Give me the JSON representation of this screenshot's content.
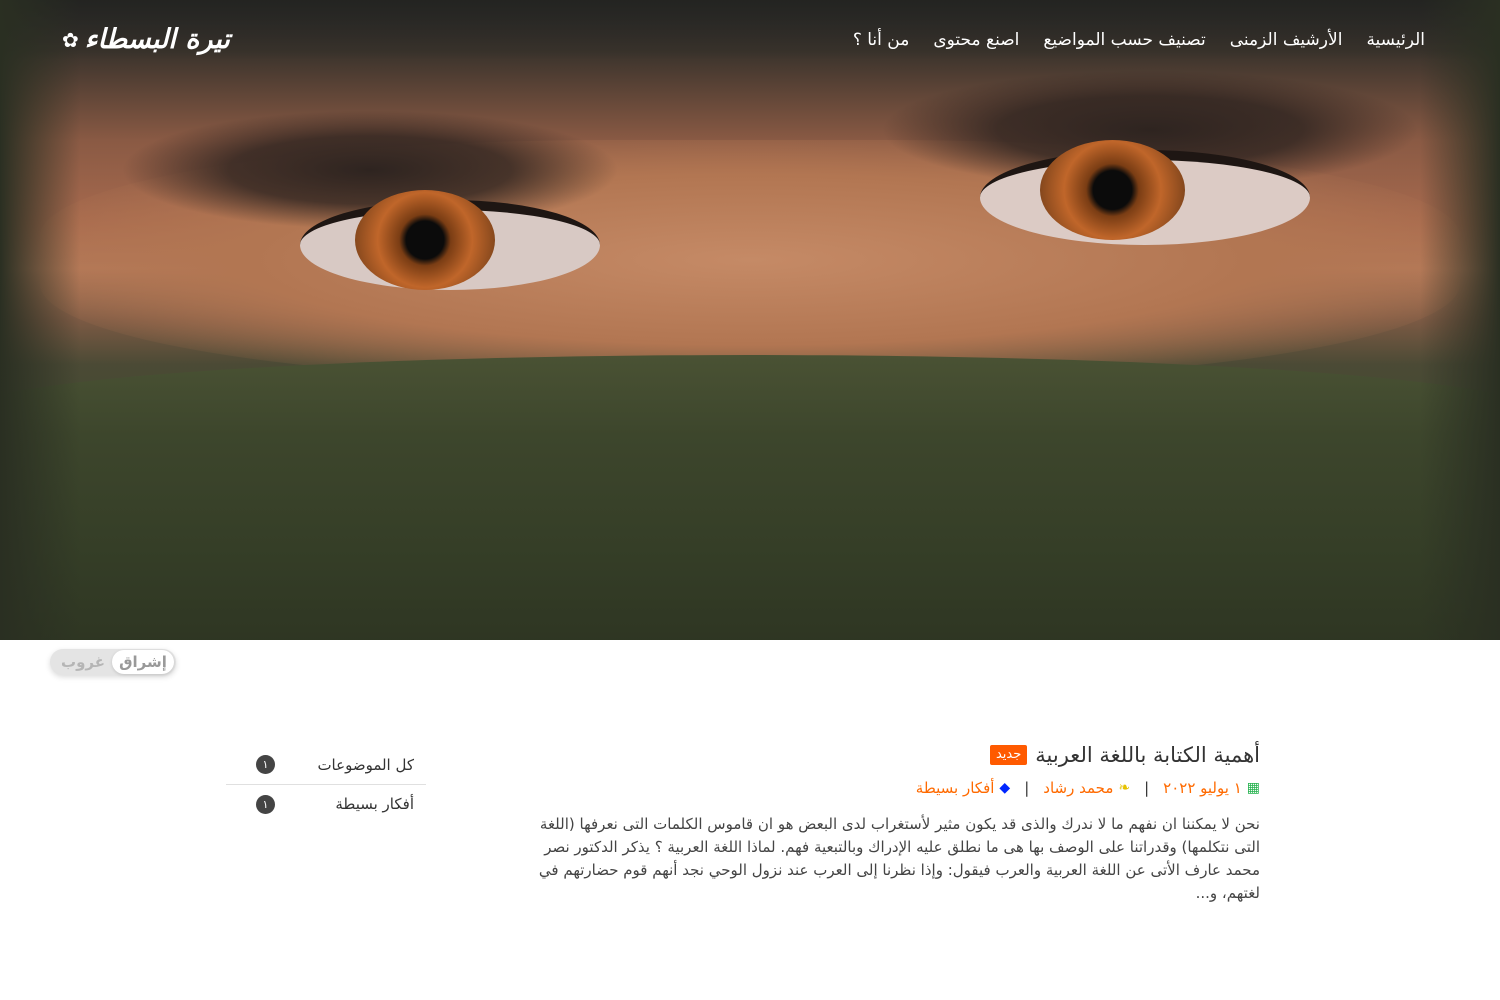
{
  "site": {
    "logo_text": "تيرة البسطاء",
    "logo_icon": "gear-icon"
  },
  "nav": {
    "items": [
      {
        "label": "الرئيسية"
      },
      {
        "label": "الأرشيف الزمنى"
      },
      {
        "label": "تصنيف حسب المواضيع"
      },
      {
        "label": "اصنع محتوى"
      },
      {
        "label": "من أنا ؟"
      }
    ]
  },
  "theme_toggle": {
    "active": "إشراق",
    "inactive": "غروب"
  },
  "post": {
    "title": "أهمية الكتابة باللغة العربية",
    "badge": "جديد",
    "date": "١ يوليو ٢٠٢٢",
    "author": "محمد رشاد",
    "category": "أفكار بسيطة",
    "separator": "|",
    "excerpt": "نحن لا يمكننا ان نفهم ما لا ندرك والذى قد يكون مثير لأستغراب لدى البعض هو ان قاموس الكلمات التى نعرفها (اللغة التى نتكلمها) وقدراتنا على الوصف بها هى ما نطلق عليه الإدراك وبالتبعية فهم. لماذا اللغة العربية ؟ يذكر الدكتور نصر محمد عارف الأتى عن اللغة العربية والعرب فيقول: وإذا نظرنا إلى العرب عند نزول الوحي نجد أنهم قوم حضارتهم في لغتهم، و..."
  },
  "sidebar": {
    "items": [
      {
        "label": "كل الموضوعات",
        "count": "١"
      },
      {
        "label": "أفكار بسيطة",
        "count": "١"
      }
    ]
  },
  "colors": {
    "accent": "#ff6a00",
    "badge": "#ff5a00",
    "date_icon": "#22b14c",
    "author_icon": "#e6c200",
    "category_icon": "#0026ff"
  }
}
